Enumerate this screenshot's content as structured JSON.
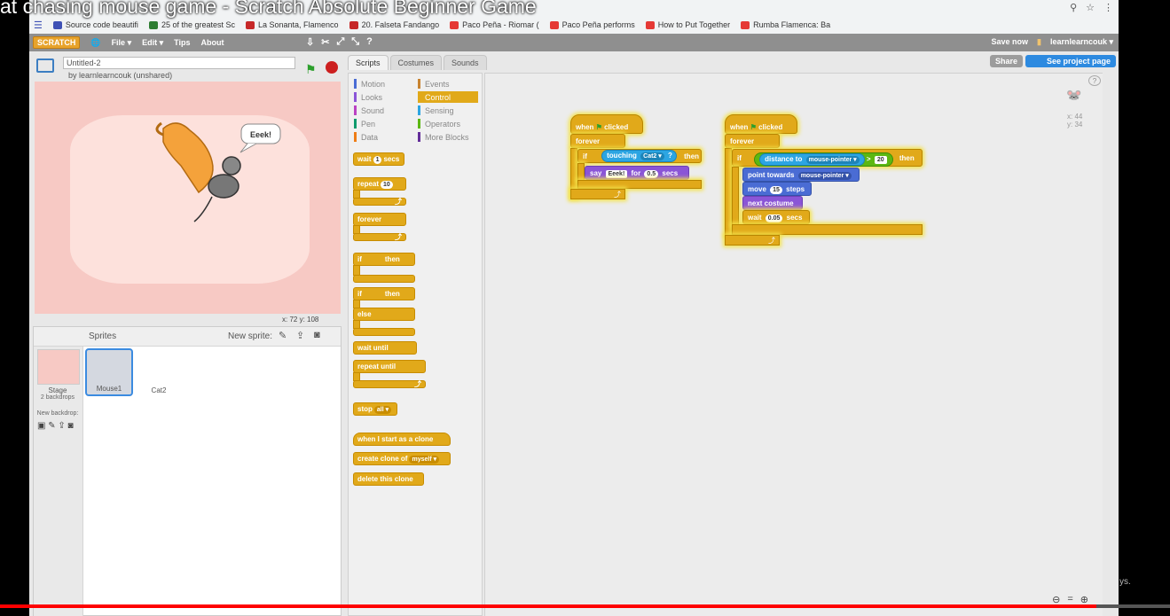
{
  "video_title": "at chasing mouse game - Scratch Absolute Beginner Game",
  "bookmarks": [
    {
      "label": "Source code beautifi",
      "color": "#3f51b5"
    },
    {
      "label": "25 of the greatest Sc",
      "color": "#2e7d32"
    },
    {
      "label": "La Sonanta, Flamenco",
      "color": "#c62828"
    },
    {
      "label": "20. Falseta Fandango",
      "color": "#c62828"
    },
    {
      "label": "Paco Peña - Riomar (",
      "color": "#e53935"
    },
    {
      "label": "Paco Peña performs",
      "color": "#e53935"
    },
    {
      "label": "How to Put Together",
      "color": "#e53935"
    },
    {
      "label": "Rumba Flamenca: Ba",
      "color": "#e53935"
    }
  ],
  "menubar": {
    "logo": "SCRATCH",
    "items": [
      "File ▾",
      "Edit ▾",
      "Tips",
      "About"
    ],
    "save_now": "Save now",
    "user": "learnlearncouk ▾"
  },
  "project": {
    "title": "Untitled-2",
    "byline": "by learnlearncouk (unshared)"
  },
  "stage": {
    "speech": "Eeek!",
    "coords": "x: 72   y: 108"
  },
  "sprites": {
    "header": "Sprites",
    "new_sprite": "New sprite:",
    "stage_label": "Stage",
    "stage_sub": "2 backdrops",
    "new_backdrop": "New backdrop:",
    "items": [
      {
        "name": "Mouse1",
        "selected": true
      },
      {
        "name": "Cat2",
        "selected": false
      }
    ]
  },
  "tabs": [
    "Scripts",
    "Costumes",
    "Sounds"
  ],
  "categories": {
    "left": [
      {
        "label": "Motion",
        "color": "#4a6cd4"
      },
      {
        "label": "Looks",
        "color": "#8a55d7"
      },
      {
        "label": "Sound",
        "color": "#bb42c3"
      },
      {
        "label": "Pen",
        "color": "#0e9a6c"
      },
      {
        "label": "Data",
        "color": "#ee7d16"
      }
    ],
    "right": [
      {
        "label": "Events",
        "color": "#c88330"
      },
      {
        "label": "Control",
        "color": "#e1a91a"
      },
      {
        "label": "Sensing",
        "color": "#2ca5e2"
      },
      {
        "label": "Operators",
        "color": "#5cb712"
      },
      {
        "label": "More Blocks",
        "color": "#632d99"
      }
    ]
  },
  "palette": {
    "wait": "wait",
    "wait_val": "1",
    "secs": "secs",
    "repeat": "repeat",
    "repeat_val": "10",
    "forever": "forever",
    "if_then_a": "if",
    "then": "then",
    "else": "else",
    "wait_until": "wait until",
    "repeat_until": "repeat until",
    "stop": "stop",
    "stop_val": "all ▾",
    "clone_start": "when I start as a clone",
    "create_clone": "create clone of",
    "create_clone_val": "myself ▾",
    "delete_clone": "delete this clone"
  },
  "script1": {
    "hat": "when",
    "clicked": "clicked",
    "forever": "forever",
    "if": "if",
    "touching": "touching",
    "target": "Cat2 ▾",
    "q": "?",
    "then": "then",
    "say": "say",
    "say_val": "Eeek!",
    "for": "for",
    "for_val": "0.5",
    "secs": "secs"
  },
  "script2": {
    "hat": "when",
    "clicked": "clicked",
    "forever": "forever",
    "if": "if",
    "distance": "distance to",
    "distance_target": "mouse-pointer ▾",
    "gt": ">",
    "gt_val": "20",
    "then": "then",
    "point": "point towards",
    "point_target": "mouse-pointer ▾",
    "move": "move",
    "move_val": "15",
    "steps": "steps",
    "next_costume": "next costume",
    "wait": "wait",
    "wait_val": "0.05",
    "secs": "secs"
  },
  "sprite_info": {
    "x": "x: 44",
    "y": "y: 34"
  },
  "share": "Share",
  "see_project": "See project page",
  "video_progress_percent": 93.7,
  "side_text": "ys.",
  "colors": {
    "accent": "#e1a91a",
    "stage": "#f7c9c4",
    "progress": "#ff0000"
  }
}
